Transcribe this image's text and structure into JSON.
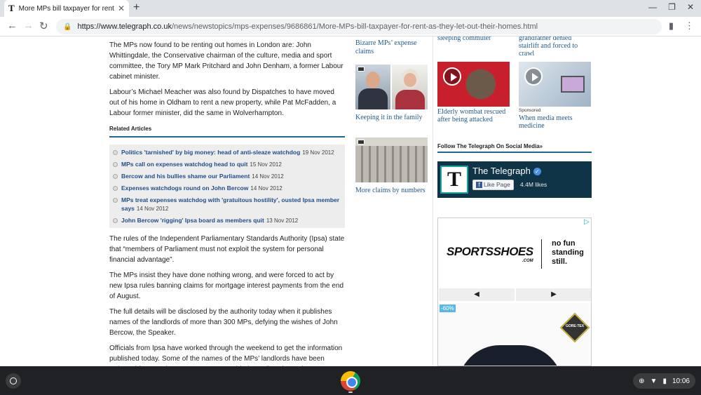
{
  "browser": {
    "tab_title": "More MPs bill taxpayer for rent a",
    "tab_favicon": "T",
    "url_host": "https://www.telegraph.co.uk",
    "url_path": "/news/newstopics/mps-expenses/9686861/More-MPs-bill-taxpayer-for-rent-as-they-let-out-their-homes.html"
  },
  "article": {
    "p1": "The MPs now found to be renting out homes in London are: John Whittingdale, the Conservative chairman of the culture, media and sport committee, the Tory MP Mark Pritchard and John Denham, a former Labour cabinet minister.",
    "p2": "Labour’s Michael Meacher was also found by Dispatches to have moved out of his home in Oldham to rent a new property, while Pat McFadden, a Labour former minister, did the same in Wolverhampton.",
    "related_heading": "Related Articles",
    "related": [
      {
        "title": "Politics 'tarnished' by big money: head of anti-sleaze watchdog",
        "date": "19 Nov 2012"
      },
      {
        "title": "MPs call on expenses watchdog head to quit",
        "date": "15 Nov 2012"
      },
      {
        "title": "Bercow and his bullies shame our Parliament",
        "date": "14 Nov 2012"
      },
      {
        "title": "Expenses watchdogs round on John Bercow",
        "date": "14 Nov 2012"
      },
      {
        "title": "MPs treat expenses watchdog with 'gratuitous hostility', ousted Ipsa member says",
        "date": "14 Nov 2012"
      },
      {
        "title": "John Bercow 'rigging' Ipsa board as members quit",
        "date": "13 Nov 2012"
      }
    ],
    "p3": "The rules of the Independent Parliamentary Standards Authority (Ipsa) state that “members of Parliament must not exploit the system for personal financial advantage”.",
    "p4": "The MPs insist they have done nothing wrong, and were forced to act by new Ipsa rules banning claims for mortgage interest payments from the end of August.",
    "p5": "The full details will be disclosed by the authority today when it publishes names of the landlords of more than 300 MPs, defying the wishes of John Bercow, the Speaker.",
    "p6": "Officials from Ipsa have worked through the weekend to get the information published today. Some of the names of the MPs’ landlords have been redacted for security reasons, sources told The Daily Telegraph."
  },
  "middle": {
    "link1": "Bizarre MPs’ expense claims",
    "link2": "Keeping it in the family",
    "link3": "More claims by numbers"
  },
  "videos": {
    "top_left": "sleeping commuter",
    "top_right": "grandfather denied stairlift and forced to crawl",
    "v1_caption": "Elderly wombat rescued after being attacked",
    "v2_sponsored": "Sponsored",
    "v2_caption": "When media meets medicine"
  },
  "social": {
    "heading": "Follow The Telegraph On Social Media»",
    "fb_name": "The Telegraph",
    "fb_like": "Like Page",
    "fb_count": "4.4M likes"
  },
  "ad": {
    "logo": "SPORTSSHOES",
    "logo_sub": ".COM",
    "tagline_1": "no fun",
    "tagline_2": "standing",
    "tagline_3": "still.",
    "prev": "◀",
    "next": "▶",
    "discount": "-60%",
    "badge": "GORE-TEX"
  },
  "shelf": {
    "time": "10:06"
  }
}
